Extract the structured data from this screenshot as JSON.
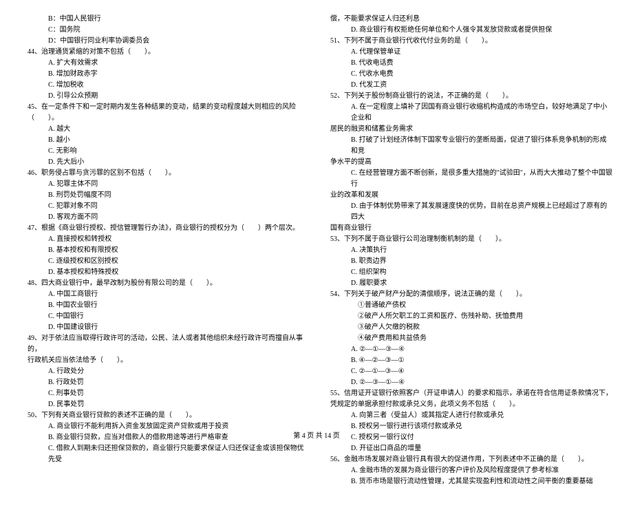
{
  "left": {
    "l1": "B：中国人民银行",
    "l2": "C：国务院",
    "l3": "D：中国银行同业利率协调委员会",
    "q44": "44、治理通货紧缩的对策不包括（　　）。",
    "q44a": "A. 扩大有效需求",
    "q44b": "B. 增加财政赤字",
    "q44c": "C. 增加税收",
    "q44d": "D. 引导公众预期",
    "q45": "45、在一定条件下和一定时期内发生各种结果的变动，结果的变动程度越大则相应的风险",
    "q45cont": "（　　）。",
    "q45a": "A. 越大",
    "q45b": "B. 越小",
    "q45c": "C. 无影响",
    "q45d": "D. 先大后小",
    "q46": "46、职务侵占罪与贪污罪的区别不包括（　　）。",
    "q46a": "A. 犯罪主体不同",
    "q46b": "B. 刑罚处罚幅度不同",
    "q46c": "C. 犯罪对象不同",
    "q46d": "D. 客观方面不同",
    "q47": "47、根据《商业银行授权、授信管理暂行办法》，商业银行的授权分为（　　）两个层次。",
    "q47a": "A. 直接授权和转授权",
    "q47b": "B. 基本授权和有限授权",
    "q47c": "C. 逐级授权和区别授权",
    "q47d": "D. 基本授权和特殊授权",
    "q48": "48、四大商业银行中，最早改制为股份有限公司的是（　　）。",
    "q48a": "A. 中国工商银行",
    "q48b": "B. 中国农业银行",
    "q48c": "C. 中国银行",
    "q48d": "D. 中国建设银行",
    "q49": "49、对于依法应当取得行政许可的活动，公民、法人或者其他组织未经行政许可而擅自从事的，",
    "q49cont": "行政机关应当依法给予（　　）。",
    "q49a": "A. 行政处分",
    "q49b": "B. 行政处罚",
    "q49c": "C. 刑事处罚",
    "q49d": "D. 民事处罚",
    "q50": "50、下列有关商业银行贷款的表述不正确的是（　　）。",
    "q50a": "A. 商业银行不能利用拆入资金发放固定资产贷款或用于投资",
    "q50b": "B. 商业银行贷款，应当对借款人的借款用途等进行严格审查",
    "q50c": "C. 借款人到期未归还担保贷款的，商业银行只能要求保证人归还保证金或该担保物优先受"
  },
  "right": {
    "r1": "偿，不能要求保证人归还利息",
    "r2": "D. 商业银行有权拒绝任何单位和个人强令其发放贷款或者提供担保",
    "q51": "51、下列不属于商业银行代收代付业务的是（　　）。",
    "q51a": "A. 代理保管单证",
    "q51b": "B. 代收电话费",
    "q51c": "C. 代收水电费",
    "q51d": "D. 代发工资",
    "q52": "52、下列关于股份制商业银行的说法，不正确的是（　　）。",
    "q52a": "A. 在一定程度上填补了因国有商业银行收缩机构造成的市场空白，较好地满足了中小企业和",
    "q52acont": "居民的融资和储蓄业务需求",
    "q52b": "B. 打破了计划经济体制下国家专业银行的垄断局面，促进了银行体系竞争机制的形成和竞",
    "q52bcont": "争水平的提高",
    "q52c": "C. 在经营管理方面不断创新，是很多重大措施的\"试验田\"，从而大大推动了整个中国银行",
    "q52ccont": "业的改革和发展",
    "q52d": "D. 由于体制优势带来了其发展速度快的优势，目前在总资产规模上已经超过了原有的四大",
    "q52dcont": "国有商业银行",
    "q53": "53、下列不属于商业银行公司治理制衡机制的是（　　）。",
    "q53a": "A. 决策执行",
    "q53b": "B. 职责边界",
    "q53c": "C. 组织架构",
    "q53d": "D. 履职要求",
    "q54": "54、下列关于破产财产分配的清偿顺序，说法正确的是（　　）。",
    "q54o1": "①普通破产债权",
    "q54o2": "②破产人所欠职工的工资和医疗、伤残补助、抚恤费用",
    "q54o3": "③破产人欠缴的税款",
    "q54o4": "④破产费用和共益债务",
    "q54a": "A. ②—①—③—④",
    "q54b": "B. ④—②—③—①",
    "q54c": "C. ②—①—③—④",
    "q54d": "D. ②—③—①—④",
    "q55": "55、信用证开证银行依照客户（开证申请人）的要求和指示，承诺在符合信用证条款情况下，",
    "q55cont": "凭规定的单据承担付款或承兑义务，此项义务不包括（　　）。",
    "q55a": "A. 向第三者（受益人）或其指定人进行付款或承兑",
    "q55b": "B. 授权另一银行进行该项付款或承兑",
    "q55c": "C. 授权另一银行议付",
    "q55d": "D. 开征出口商品的增量",
    "q56": "56、金融市场发展对商业银行具有很大的促进作用，下列表述中不正确的是（　　）。",
    "q56a": "A. 金融市场的发展为商业银行的客户评价及风险程度提供了参考标准",
    "q56b": "B. 货币市场是银行流动性管理，尤其是实现盈利性和流动性之间平衡的重要基础"
  },
  "footer": "第 4 页  共 14 页"
}
